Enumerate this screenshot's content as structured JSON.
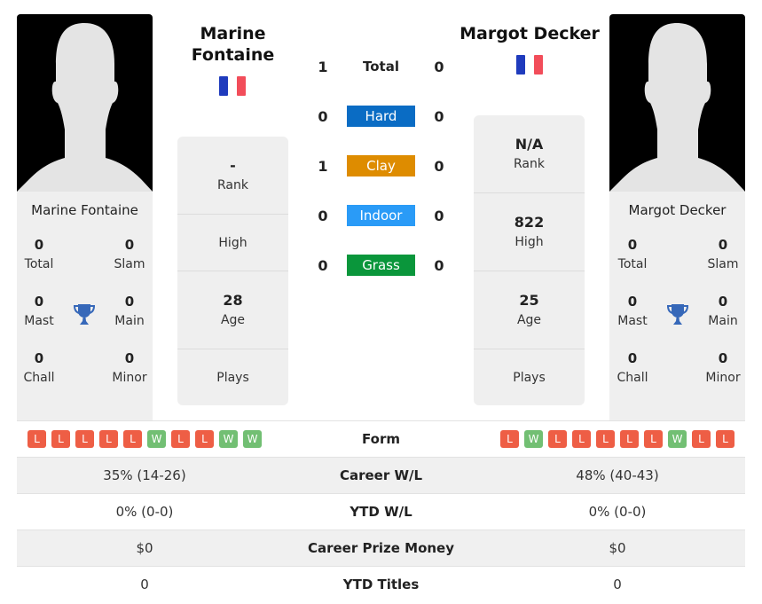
{
  "colors": {
    "hard": "#0a6cc4",
    "clay": "#de8c00",
    "indoor": "#2a9bf7",
    "grass": "#0a963b",
    "loss": "#ee5e45",
    "win": "#72bf73",
    "trophy": "#3668b9"
  },
  "player1": {
    "name": "Marine Fontaine",
    "name_line1": "Marine",
    "name_line2": "Fontaine",
    "flag": "france-flag",
    "titles": {
      "total": {
        "value": "0",
        "label": "Total"
      },
      "slam": {
        "value": "0",
        "label": "Slam"
      },
      "mast": {
        "value": "0",
        "label": "Mast"
      },
      "main": {
        "value": "0",
        "label": "Main"
      },
      "chall": {
        "value": "0",
        "label": "Chall"
      },
      "minor": {
        "value": "0",
        "label": "Minor"
      }
    },
    "rank": {
      "value": "-",
      "label": "Rank"
    },
    "high": {
      "value": "",
      "label": "High"
    },
    "age": {
      "value": "28",
      "label": "Age"
    },
    "plays": {
      "value": "",
      "label": "Plays"
    },
    "form": [
      "L",
      "L",
      "L",
      "L",
      "L",
      "W",
      "L",
      "L",
      "W",
      "W"
    ]
  },
  "player2": {
    "name": "Margot Decker",
    "flag": "france-flag",
    "titles": {
      "total": {
        "value": "0",
        "label": "Total"
      },
      "slam": {
        "value": "0",
        "label": "Slam"
      },
      "mast": {
        "value": "0",
        "label": "Mast"
      },
      "main": {
        "value": "0",
        "label": "Main"
      },
      "chall": {
        "value": "0",
        "label": "Chall"
      },
      "minor": {
        "value": "0",
        "label": "Minor"
      }
    },
    "rank": {
      "value": "N/A",
      "label": "Rank"
    },
    "high": {
      "value": "822",
      "label": "High"
    },
    "age": {
      "value": "25",
      "label": "Age"
    },
    "plays": {
      "value": "",
      "label": "Plays"
    },
    "form": [
      "L",
      "W",
      "L",
      "L",
      "L",
      "L",
      "L",
      "W",
      "L",
      "L"
    ]
  },
  "h2h": [
    {
      "label": "Total",
      "p1": "1",
      "p2": "0",
      "surface": "total"
    },
    {
      "label": "Hard",
      "p1": "0",
      "p2": "0",
      "surface": "hard"
    },
    {
      "label": "Clay",
      "p1": "1",
      "p2": "0",
      "surface": "clay"
    },
    {
      "label": "Indoor",
      "p1": "0",
      "p2": "0",
      "surface": "indoor"
    },
    {
      "label": "Grass",
      "p1": "0",
      "p2": "0",
      "surface": "grass"
    }
  ],
  "comparison": [
    {
      "label": "Form",
      "p1": "",
      "p2": ""
    },
    {
      "label": "Career W/L",
      "p1": "35% (14-26)",
      "p2": "48% (40-43)"
    },
    {
      "label": "YTD W/L",
      "p1": "0% (0-0)",
      "p2": "0% (0-0)"
    },
    {
      "label": "Career Prize Money",
      "p1": "$0",
      "p2": "$0"
    },
    {
      "label": "YTD Titles",
      "p1": "0",
      "p2": "0"
    }
  ]
}
